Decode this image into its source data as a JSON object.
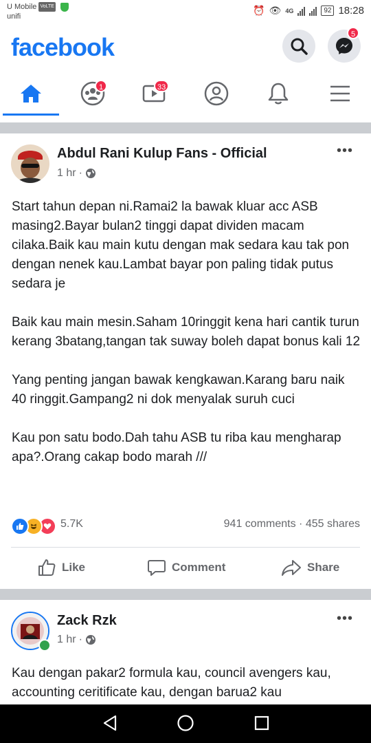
{
  "status_bar": {
    "carrier": "U Mobile",
    "network": "unifi",
    "volte": "VoLTE",
    "network_type": "4G",
    "battery": "92",
    "time": "18:28"
  },
  "header": {
    "logo": "facebook",
    "messenger_badge": "5"
  },
  "tabs": [
    {
      "name": "home",
      "icon": "home-icon",
      "badge": ""
    },
    {
      "name": "groups",
      "icon": "groups-icon",
      "badge": "1"
    },
    {
      "name": "watch",
      "icon": "video-icon",
      "badge": "33"
    },
    {
      "name": "profile",
      "icon": "profile-icon",
      "badge": ""
    },
    {
      "name": "notifications",
      "icon": "bell-icon",
      "badge": ""
    },
    {
      "name": "menu",
      "icon": "menu-icon",
      "badge": ""
    }
  ],
  "posts": [
    {
      "author": "Abdul Rani Kulup Fans - Official",
      "time": "1 hr",
      "privacy_icon": "globe-icon",
      "paragraphs": [
        "Start tahun depan ni.Ramai2 la bawak kluar acc ASB masing2.Bayar bulan2 tinggi dapat dividen macam cilaka.Baik kau main kutu dengan mak sedara kau tak pon dengan nenek kau.Lambat bayar pon paling tidak putus sedara je",
        "Baik kau main mesin.Saham 10ringgit kena hari cantik turun kerang 3batang,tangan tak suway boleh dapat bonus kali 12",
        "Yang penting jangan bawak kengkawan.Karang baru naik 40 ringgit.Gampang2 ni dok menyalak suruh cuci",
        "Kau pon satu bodo.Dah tahu ASB tu riba kau mengharap apa?.Orang cakap bodo marah ///"
      ],
      "reactions_count": "5.7K",
      "comments": "941 comments",
      "shares": "455 shares",
      "actions": {
        "like": "Like",
        "comment": "Comment",
        "share": "Share"
      }
    },
    {
      "author": "Zack Rzk",
      "time": "1 hr",
      "privacy_icon": "globe-icon",
      "paragraphs": [
        "Kau dengan pakar2 formula kau, council avengers kau, accounting ceritificate kau, dengan barua2 kau"
      ]
    }
  ],
  "colors": {
    "brand": "#1877f2",
    "badge": "#f02849",
    "secondary_text": "#65676b",
    "divider": "#cacdd1"
  }
}
